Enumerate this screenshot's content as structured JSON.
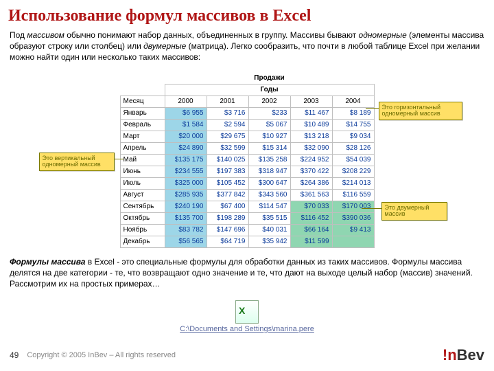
{
  "title": "Использование формул массивов в Excel",
  "p1a": "Под ",
  "p1b": "массивом",
  "p1c": " обычно понимают набор данных, объединенных в группу. Массивы бывают ",
  "p1d": "одномерные",
  "p1e": " (элементы массива образуют строку или столбец) или ",
  "p1f": "двумерные",
  "p1g": " (матрица). Легко сообразить, что почти в любой таблице Excel при желании можно найти один или несколько таких массивов:",
  "p2a": "Формулы массива",
  "p2b": " в Excel - это специальные формулы для обработки данных из таких массивов. Формулы массива делятся на две категории - те, что возвращают одно значение и те, что дают на выходе целый набор (массив) значений. Рассмотрим их на простых примерах…",
  "tbl": {
    "mainTitle": "Продажи",
    "group": "Годы",
    "monthHead": "Месяц",
    "years": [
      "2000",
      "2001",
      "2002",
      "2003",
      "2004"
    ],
    "months": [
      "Январь",
      "Февраль",
      "Март",
      "Апрель",
      "Май",
      "Июнь",
      "Июль",
      "Август",
      "Сентябрь",
      "Октябрь",
      "Ноябрь",
      "Декабрь"
    ],
    "data": [
      [
        "$6 955",
        "$3 716",
        "$233",
        "$11 467",
        "$8 189"
      ],
      [
        "$1 584",
        "$2 594",
        "$5 067",
        "$10 489",
        "$14 755"
      ],
      [
        "$20 000",
        "$29 675",
        "$10 927",
        "$13 218",
        "$9 034"
      ],
      [
        "$24 890",
        "$32 599",
        "$15 314",
        "$32 090",
        "$28 126"
      ],
      [
        "$135 175",
        "$140 025",
        "$135 258",
        "$224 952",
        "$54 039"
      ],
      [
        "$234 555",
        "$197 383",
        "$318 947",
        "$370 422",
        "$208 229"
      ],
      [
        "$325 000",
        "$105 452",
        "$300 647",
        "$264 386",
        "$214 013"
      ],
      [
        "$285 935",
        "$377 842",
        "$343 560",
        "$361 563",
        "$116 559"
      ],
      [
        "$240 190",
        "$67 400",
        "$114 547",
        "$70 033",
        "$170 003"
      ],
      [
        "$135 700",
        "$198 289",
        "$35 515",
        "$116 452",
        "$390 036"
      ],
      [
        "$83 782",
        "$147 696",
        "$40 031",
        "$66 164",
        "$9 413"
      ],
      [
        "$56 565",
        "$64 719",
        "$35 942",
        "$11 599",
        ""
      ]
    ]
  },
  "callout1": "Это вертикальный одномерный массив",
  "callout2": "Это горизонтальный одномерный массив",
  "callout3": "Это двумерный массив",
  "linkPath": "C:\\Documents and Settings\\marina.pere",
  "pageNum": "49",
  "copyright": "Copyright © 2005 InBev – All rights reserved",
  "logo": {
    "bang": "!n",
    "rest": "Bev"
  }
}
